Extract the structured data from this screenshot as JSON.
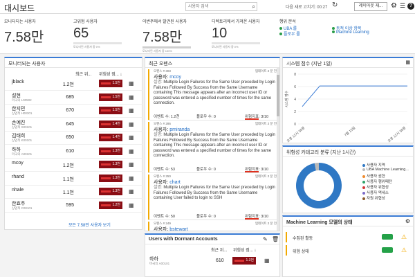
{
  "header": {
    "app_title": "대시보드",
    "search_placeholder": "사용자 검색",
    "refresh_label": "다음 새로 고치기: 00:27",
    "layout_button": "레이아웃 재..."
  },
  "stats": [
    {
      "label": "모니터되는 사용자",
      "value": "7.58만",
      "sub": "모니터된 사용자 중 0%"
    },
    {
      "label": "고위험 사용자",
      "value": "65",
      "sub": "모니터된 사용자 중 0%"
    },
    {
      "label": "이번주에서 발견된 사용자",
      "value": "7.58만",
      "sub": "모니터된 사용자 중 100%"
    },
    {
      "label": "디렉토리에서 가져온 사용자",
      "value": "10",
      "sub": "모니터된 사용자 중 0%"
    }
  ],
  "risk_analysis": {
    "title": "행위 분석",
    "items": [
      "UBA 룰",
      "플로우 룰",
      "동적 이상 항목",
      "Machine Learning"
    ]
  },
  "monitored_users": {
    "title": "모니터되는 사용자",
    "col_recent": "최근 위...",
    "col_risk": "위험성 점...",
    "rows": [
      {
        "name": "jblack",
        "sub": "",
        "count": "1.2천",
        "risk": "1.5천"
      },
      {
        "name": "설현",
        "sub": "마국의 L00502",
        "count": "685",
        "risk": "1.5천"
      },
      {
        "name": "한지민",
        "sub": "상업적 H00301",
        "count": "670",
        "risk": "1.5천"
      },
      {
        "name": "손예진",
        "sub": "상업적 S00101",
        "count": "645",
        "risk": "1.4천"
      },
      {
        "name": "김태희",
        "sub": "상업적 K00101",
        "count": "650",
        "risk": "1.4천"
      },
      {
        "name": "하하",
        "sub": "마국의 A00101",
        "count": "610",
        "risk": "1.3천"
      },
      {
        "name": "mcoy",
        "sub": "",
        "count": "1.2천",
        "risk": "1.3천"
      },
      {
        "name": "rhand",
        "sub": "",
        "count": "1.1천",
        "risk": "1.3천"
      },
      {
        "name": "nhale",
        "sub": "",
        "count": "1.1천",
        "risk": "1.3천"
      },
      {
        "name": "한효주",
        "sub": "상업적 C00101",
        "count": "595",
        "risk": "1.2천"
      }
    ],
    "footer_link": "모든 7.58만 사용자 보기"
  },
  "offenses": {
    "title": "최근 오펜스",
    "items": [
      {
        "id": "오펜스 # 303",
        "updated": "업데이트 2 분 전",
        "user_label": "사용자:",
        "user": "mcoy",
        "desc_label": "설명:",
        "desc": "Multiple Login Failures for the Same User preceded by Login Failures Followed By Success from the Same Username containing This message appears after an incorrect user ID or password was entered a specified number of times for the same connection.",
        "events": "이벤트 수: 1.2천",
        "flows": "플로우 수: 0",
        "risk": "위험지표: 3/10"
      },
      {
        "id": "오펜스 # 286",
        "updated": "업데이트 2 분 전",
        "user_label": "사용자:",
        "user": "pmiranda",
        "desc_label": "설명:",
        "desc": "Multiple Login Failures for the Same User preceded by Login Failures Followed By Success from the Same Username containing This message appears after an incorrect user ID or password was entered a specified number of times for the same connection.",
        "events": "이벤트 수: 53",
        "flows": "플로우 수: 0",
        "risk": "위험지표: 3/10"
      },
      {
        "id": "오펜스 # 250",
        "updated": "업데이트 2 분 전",
        "user_label": "사용자:",
        "user": "chart",
        "desc_label": "설명:",
        "desc": "Multiple Login Failures for the Same User preceded by Login Failures Followed By Success from the Same Username containing User failed to login to SSH",
        "events": "이벤트 수: 50",
        "flows": "플로우 수: 0",
        "risk": "위험지표: 3/10"
      },
      {
        "id": "오펜스 # 249",
        "updated": "업데이트 2 분 전",
        "user_label": "사용자:",
        "user": "bstewart",
        "desc_label": "",
        "desc": "",
        "events": "",
        "flows": "",
        "risk": ""
      }
    ]
  },
  "dormant": {
    "title": "Users with Dormant Accounts",
    "col_recent": "최근 위...",
    "col_risk": "위험성 점...",
    "rows": [
      {
        "name": "하하",
        "sub": "마국의 A00101",
        "count": "610",
        "risk": "1.3천"
      }
    ]
  },
  "system_score": {
    "title": "시스템 점수 (지난 1일)",
    "ylabel": "시스템 점수",
    "chart_data": {
      "type": "line",
      "title": "시스템 점수 (지난 1일)",
      "ylabel": "시스템 점수",
      "x": [
        "오후 12시 30분",
        "7월 15일",
        "오후 12시 30분"
      ],
      "yticks": [
        0,
        2,
        4,
        6,
        8
      ],
      "ylim": [
        0,
        8
      ],
      "series": [
        {
          "values": [
            2.8,
            6.1,
            6.1,
            6.1,
            6.1,
            6.1,
            6.1
          ]
        }
      ]
    }
  },
  "risk_category": {
    "title": "위험성 카테고리 분류 (지난 1시간)",
    "chart_data": {
      "type": "pie",
      "categories": [
        "사용자 지역",
        "UBA Machine Learning...",
        "사용자 권한",
        "사용자 행위패턴",
        "사용자 위협성",
        "사용자 액세스",
        "자원 위협성"
      ],
      "values": [
        97,
        3,
        0,
        0,
        0,
        0,
        0
      ],
      "colors": [
        "#2f78c4",
        "#b9b9b9",
        "#ef8a2c",
        "#2fa36b",
        "#d43535",
        "#7a6ac9",
        "#8b5a2b"
      ]
    }
  },
  "ml_status": {
    "title": "Machine Learning 모델의 상태",
    "rows": [
      {
        "label": "수집된 활동"
      },
      {
        "label": "위험 상태"
      }
    ]
  },
  "colors": {
    "accent": "#3a7bd5",
    "risk_badge": "#8a0d14",
    "offense_stripe": "#f2a900",
    "link": "#1d6ac4"
  }
}
